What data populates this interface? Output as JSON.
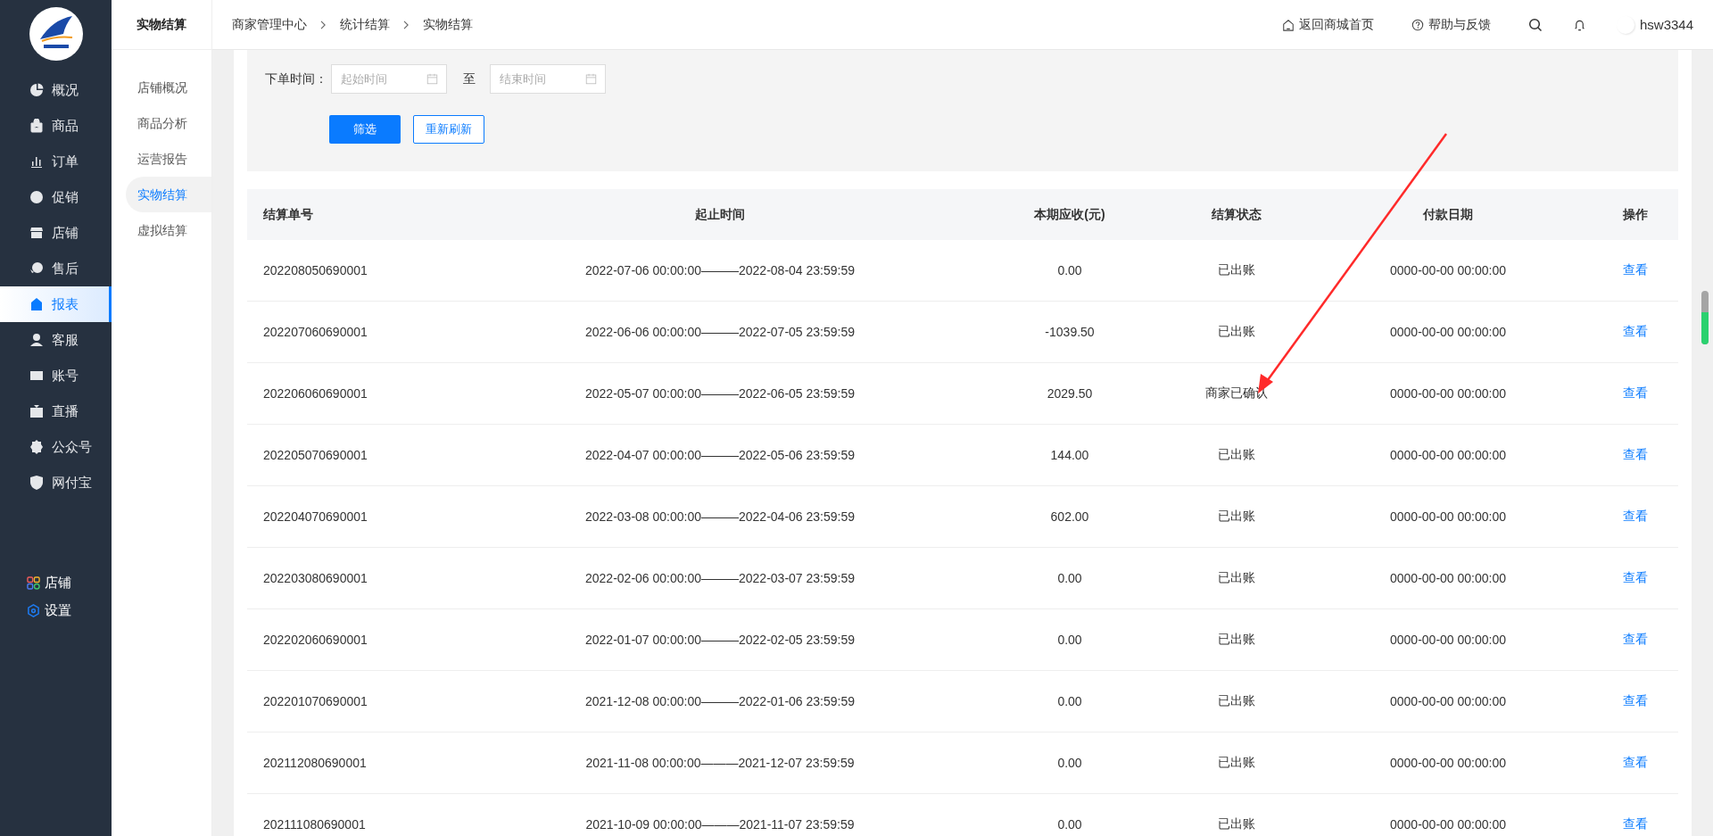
{
  "sidebar": {
    "items": [
      {
        "label": "概况",
        "selected": false
      },
      {
        "label": "商品",
        "selected": false
      },
      {
        "label": "订单",
        "selected": false
      },
      {
        "label": "促销",
        "selected": false
      },
      {
        "label": "店铺",
        "selected": false
      },
      {
        "label": "售后",
        "selected": false
      },
      {
        "label": "报表",
        "selected": true
      },
      {
        "label": "客服",
        "selected": false
      },
      {
        "label": "账号",
        "selected": false
      },
      {
        "label": "直播",
        "selected": false
      },
      {
        "label": "公众号",
        "selected": false
      },
      {
        "label": "网付宝",
        "selected": false
      }
    ],
    "footer_items": [
      {
        "label": "店铺"
      },
      {
        "label": "设置"
      }
    ]
  },
  "subnav": {
    "title": "实物结算",
    "items": [
      {
        "label": "店铺概况",
        "selected": false
      },
      {
        "label": "商品分析",
        "selected": false
      },
      {
        "label": "运营报告",
        "selected": false
      },
      {
        "label": "实物结算",
        "selected": true
      },
      {
        "label": "虚拟结算",
        "selected": false
      }
    ]
  },
  "breadcrumb": [
    "商家管理中心",
    "统计结算",
    "实物结算"
  ],
  "header_links": [
    {
      "label": "返回商城首页"
    },
    {
      "label": "帮助与反馈"
    }
  ],
  "user": "hsw3344",
  "filter": {
    "label": "下单时间：",
    "start_placeholder": "起始时间",
    "separator": "至",
    "end_placeholder": "结束时间",
    "buttons": [
      "筛选",
      "重新刷新"
    ]
  },
  "table": {
    "columns": [
      "结算单号",
      "起止时间",
      "本期应收(元)",
      "结算状态",
      "付款日期",
      "操作"
    ],
    "rows": [
      [
        "202208050690001",
        "2022-07-06 00:00:00———2022-08-04 23:59:59",
        "0.00",
        "已出账",
        "0000-00-00 00:00:00",
        "查看"
      ],
      [
        "202207060690001",
        "2022-06-06 00:00:00———2022-07-05 23:59:59",
        "-1039.50",
        "已出账",
        "0000-00-00 00:00:00",
        "查看"
      ],
      [
        "202206060690001",
        "2022-05-07 00:00:00———2022-06-05 23:59:59",
        "2029.50",
        "商家已确认",
        "0000-00-00 00:00:00",
        "查看"
      ],
      [
        "202205070690001",
        "2022-04-07 00:00:00———2022-05-06 23:59:59",
        "144.00",
        "已出账",
        "0000-00-00 00:00:00",
        "查看"
      ],
      [
        "202204070690001",
        "2022-03-08 00:00:00———2022-04-06 23:59:59",
        "602.00",
        "已出账",
        "0000-00-00 00:00:00",
        "查看"
      ],
      [
        "202203080690001",
        "2022-02-06 00:00:00———2022-03-07 23:59:59",
        "0.00",
        "已出账",
        "0000-00-00 00:00:00",
        "查看"
      ],
      [
        "202202060690001",
        "2022-01-07 00:00:00———2022-02-05 23:59:59",
        "0.00",
        "已出账",
        "0000-00-00 00:00:00",
        "查看"
      ],
      [
        "202201070690001",
        "2021-12-08 00:00:00———2022-01-06 23:59:59",
        "0.00",
        "已出账",
        "0000-00-00 00:00:00",
        "查看"
      ],
      [
        "202112080690001",
        "2021-11-08 00:00:00———2021-12-07 23:59:59",
        "0.00",
        "已出账",
        "0000-00-00 00:00:00",
        "查看"
      ],
      [
        "202111080690001",
        "2021-10-09 00:00:00———2021-11-07 23:59:59",
        "0.00",
        "已出账",
        "0000-00-00 00:00:00",
        "查看"
      ]
    ]
  }
}
